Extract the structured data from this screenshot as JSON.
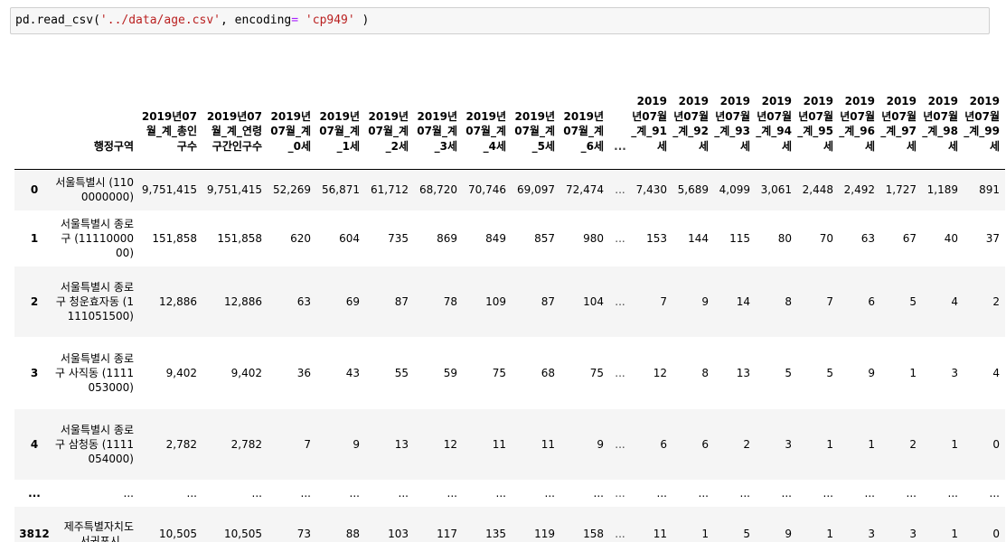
{
  "code_cell": {
    "prefix": "pd.read_csv(",
    "path": "'../data/age.csv'",
    "mid": ", encoding",
    "eq": "=",
    "space": " ",
    "enc": "'cp949'",
    "suffix": " )"
  },
  "table": {
    "columns": [
      "행정구역",
      "2019년07월_계_총인구수",
      "2019년07월_계_연령구간인구수",
      "2019년07월_계_0세",
      "2019년07월_계_1세",
      "2019년07월_계_2세",
      "2019년07월_계_3세",
      "2019년07월_계_4세",
      "2019년07월_계_5세",
      "2019년07월_계_6세",
      "...",
      "2019년07월_계_91세",
      "2019년07월_계_92세",
      "2019년07월_계_93세",
      "2019년07월_계_94세",
      "2019년07월_계_95세",
      "2019년07월_계_96세",
      "2019년07월_계_97세",
      "2019년07월_계_98세",
      "2019년07월_계_99세"
    ],
    "rows": [
      {
        "index": "0",
        "values": [
          "서울특별시 (1100000000)",
          "9,751,415",
          "9,751,415",
          "52,269",
          "56,871",
          "61,712",
          "68,720",
          "70,746",
          "69,097",
          "72,474",
          "...",
          "7,430",
          "5,689",
          "4,099",
          "3,061",
          "2,448",
          "2,492",
          "1,727",
          "1,189",
          "891"
        ]
      },
      {
        "index": "1",
        "values": [
          "서울특별시 종로구 (1111000000)",
          "151,858",
          "151,858",
          "620",
          "604",
          "735",
          "869",
          "849",
          "857",
          "980",
          "...",
          "153",
          "144",
          "115",
          "80",
          "70",
          "63",
          "67",
          "40",
          "37"
        ]
      },
      {
        "index": "2",
        "values": [
          "서울특별시 종로구 청운효자동 (1111051500)",
          "12,886",
          "12,886",
          "63",
          "69",
          "87",
          "78",
          "109",
          "87",
          "104",
          "...",
          "7",
          "9",
          "14",
          "8",
          "7",
          "6",
          "5",
          "4",
          "2"
        ]
      },
      {
        "index": "3",
        "values": [
          "서울특별시 종로구 사직동 (1111053000)",
          "9,402",
          "9,402",
          "36",
          "43",
          "55",
          "59",
          "75",
          "68",
          "75",
          "...",
          "12",
          "8",
          "13",
          "5",
          "5",
          "9",
          "1",
          "3",
          "4"
        ]
      },
      {
        "index": "4",
        "values": [
          "서울특별시 종로구 삼청동 (1111054000)",
          "2,782",
          "2,782",
          "7",
          "9",
          "13",
          "12",
          "11",
          "11",
          "9",
          "...",
          "6",
          "6",
          "2",
          "3",
          "1",
          "1",
          "2",
          "1",
          "0"
        ]
      },
      {
        "index": "...",
        "values": [
          "...",
          "...",
          "...",
          "...",
          "...",
          "...",
          "...",
          "...",
          "...",
          "...",
          "...",
          "...",
          "...",
          "...",
          "...",
          "...",
          "...",
          "...",
          "...",
          "..."
        ]
      },
      {
        "index": "3812",
        "values": [
          "제주특별자치도 서귀포시 ...",
          "10,505",
          "10,505",
          "73",
          "88",
          "103",
          "117",
          "135",
          "119",
          "158",
          "...",
          "11",
          "1",
          "5",
          "9",
          "1",
          "3",
          "3",
          "1",
          "0"
        ]
      }
    ]
  }
}
